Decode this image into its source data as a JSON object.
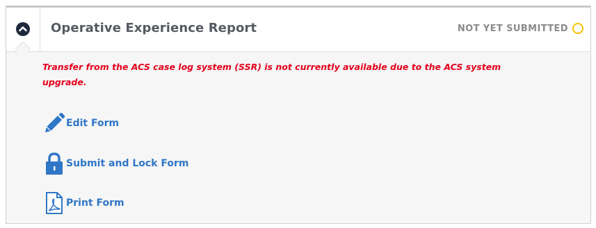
{
  "panel": {
    "title": "Operative Experience Report",
    "status": {
      "text": "NOT YET SUBMITTED",
      "color": "#f3c300"
    },
    "toggle_icon": "chevron-up-icon"
  },
  "notice": {
    "text": "Transfer from the ACS case log system (SSR) is not currently available due to the ACS system upgrade.",
    "color": "#e4001b"
  },
  "actions": [
    {
      "label": "Edit Form",
      "icon": "pencil-icon"
    },
    {
      "label": "Submit and Lock Form",
      "icon": "lock-icon"
    },
    {
      "label": "Print Form",
      "icon": "pdf-file-icon"
    }
  ],
  "colors": {
    "accent": "#2f76c6",
    "header_text": "#555a62",
    "status_text": "#8a8a8a"
  }
}
